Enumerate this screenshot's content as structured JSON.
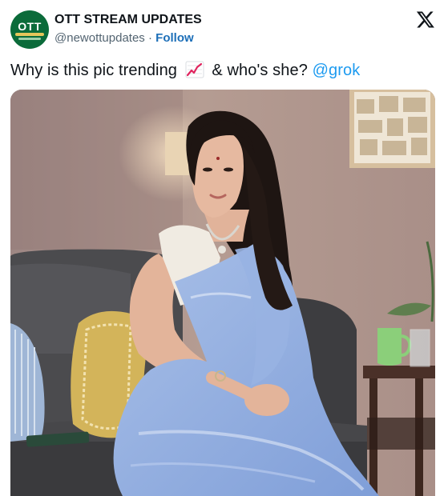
{
  "post": {
    "author": {
      "avatar_text": "OTT",
      "display_name": "OTT STREAM UPDATES",
      "handle": "@newottupdates",
      "separator": " · ",
      "follow_label": "Follow"
    },
    "text": {
      "before_icon": "Why is this pic trending",
      "icon": "chart-increasing-icon",
      "after_icon": "& who's she?",
      "mention": "@grok"
    },
    "platform_logo": "x-logo-icon",
    "media": {
      "type": "photo",
      "content": "woman-in-blue-saree-seated-on-sofa"
    }
  },
  "colors": {
    "accent": "#1d9bf0",
    "follow": "#1d6fb8",
    "text": "#0f1419",
    "muted": "#536471",
    "avatar_bg": "#0b6b3a"
  }
}
